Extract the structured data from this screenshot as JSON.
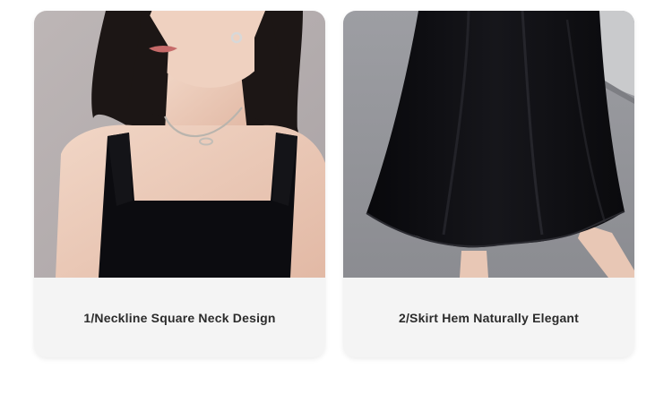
{
  "cards": [
    {
      "caption": "1/Neckline Square Neck Design",
      "image_subject": "woman-in-black-square-neck-dress"
    },
    {
      "caption": "2/Skirt Hem Naturally Elegant",
      "image_subject": "black-skirt-hem-on-pavement"
    }
  ],
  "colors": {
    "card_background": "#f4f4f4",
    "caption_text": "#2b2b2b",
    "dress_black": "#0c0c10"
  }
}
